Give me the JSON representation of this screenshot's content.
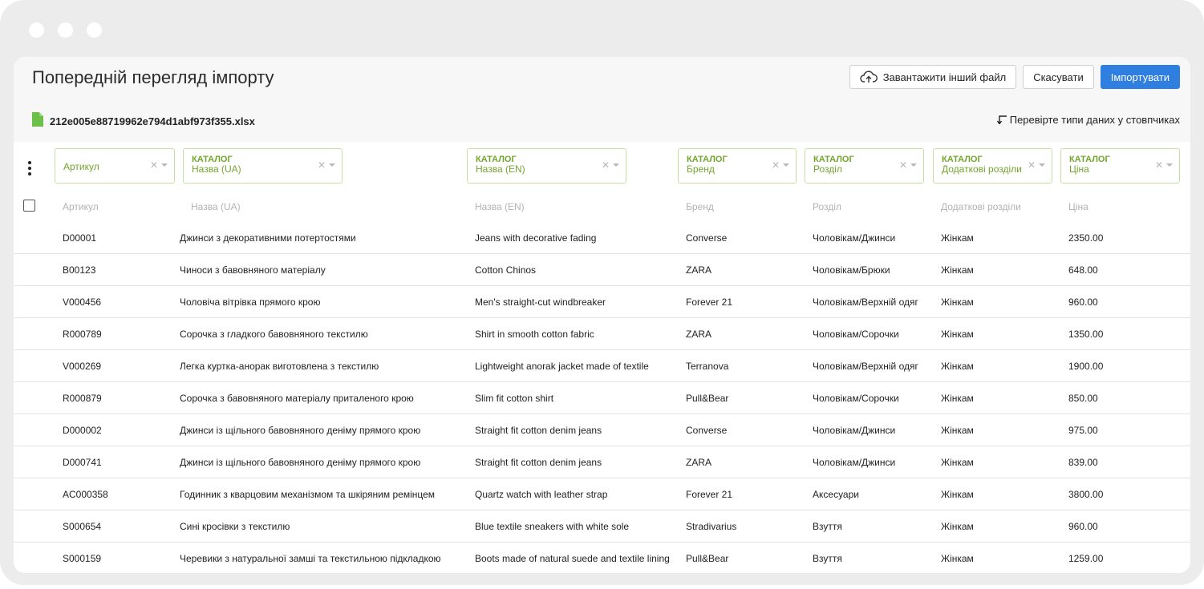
{
  "header": {
    "title": "Попередній перегляд імпорту",
    "upload_label": "Завантажити інший файл",
    "cancel_label": "Скасувати",
    "import_label": "Імпортувати",
    "file_name": "212e005e88719962e794d1abf973f355.xlsx",
    "hint": "Перевірте типи даних у стовпчиках"
  },
  "mapping": [
    {
      "category": "",
      "field": "Артикул"
    },
    {
      "category": "КАТАЛОГ",
      "field": "Назва (UA)"
    },
    {
      "category": "КАТАЛОГ",
      "field": "Назва (EN)"
    },
    {
      "category": "КАТАЛОГ",
      "field": "Бренд"
    },
    {
      "category": "КАТАЛОГ",
      "field": "Розділ"
    },
    {
      "category": "КАТАЛОГ",
      "field": "Додаткові розділи"
    },
    {
      "category": "КАТАЛОГ",
      "field": "Ціна"
    }
  ],
  "columns": [
    "Артикул",
    "Назва (UA)",
    "Назва (EN)",
    "Бренд",
    "Розділ",
    "Додаткові розділи",
    "Ціна"
  ],
  "rows": [
    [
      "D00001",
      "Джинси з декоративними потертостями",
      "Jeans with decorative fading",
      "Converse",
      "Чоловікам/Джинси",
      "Жінкам",
      "2350.00"
    ],
    [
      "B00123",
      "Чиноси з бавовняного матеріалу",
      "Cotton Chinos",
      "ZARA",
      "Чоловікам/Брюки",
      "Жінкам",
      "648.00"
    ],
    [
      "V000456",
      "Чоловіча вітрівка прямого крою",
      "Men's straight-cut windbreaker",
      "Forever 21",
      "Чоловікам/Верхній одяг",
      "Жінкам",
      "960.00"
    ],
    [
      "R000789",
      "Сорочка з гладкого бавовняного текстилю",
      "Shirt in smooth cotton fabric",
      "ZARA",
      "Чоловікам/Сорочки",
      "Жінкам",
      "1350.00"
    ],
    [
      "V000269",
      "Легка куртка-анорак виготовлена з текстилю",
      "Lightweight anorak jacket made of textile",
      "Terranova",
      "Чоловікам/Верхній одяг",
      "Жінкам",
      "1900.00"
    ],
    [
      "R000879",
      "Сорочка з бавовняного матеріалу приталеного крою",
      "Slim fit cotton shirt",
      "Pull&Bear",
      "Чоловікам/Сорочки",
      "Жінкам",
      "850.00"
    ],
    [
      "D000002",
      "Джинси із щільного бавовняного деніму прямого крою",
      "Straight fit cotton denim jeans",
      "Converse",
      "Чоловікам/Джинси",
      "Жінкам",
      "975.00"
    ],
    [
      "D000741",
      "Джинси із щільного бавовняного деніму прямого крою",
      "Straight fit cotton denim jeans",
      "ZARA",
      "Чоловікам/Джинси",
      "Жінкам",
      "839.00"
    ],
    [
      "AC000358",
      "Годинник з кварцовим механізмом та шкіряним ремінцем",
      "Quartz watch with leather strap",
      "Forever 21",
      "Аксесуари",
      "Жінкам",
      "3800.00"
    ],
    [
      "S000654",
      "Сині кросівки з текстилю",
      "Blue textile sneakers with white sole",
      "Stradivarius",
      "Взуття",
      "Жінкам",
      "960.00"
    ],
    [
      "S000159",
      "Черевики з натуральної замші та текстильною підкладкою",
      "Boots made of natural suede and textile lining",
      "Pull&Bear",
      "Взуття",
      "Жінкам",
      "1259.00"
    ]
  ],
  "colors": {
    "accent": "#2f7fe0",
    "mapped": "#73a52e",
    "file_icon": "#6cc04a"
  }
}
